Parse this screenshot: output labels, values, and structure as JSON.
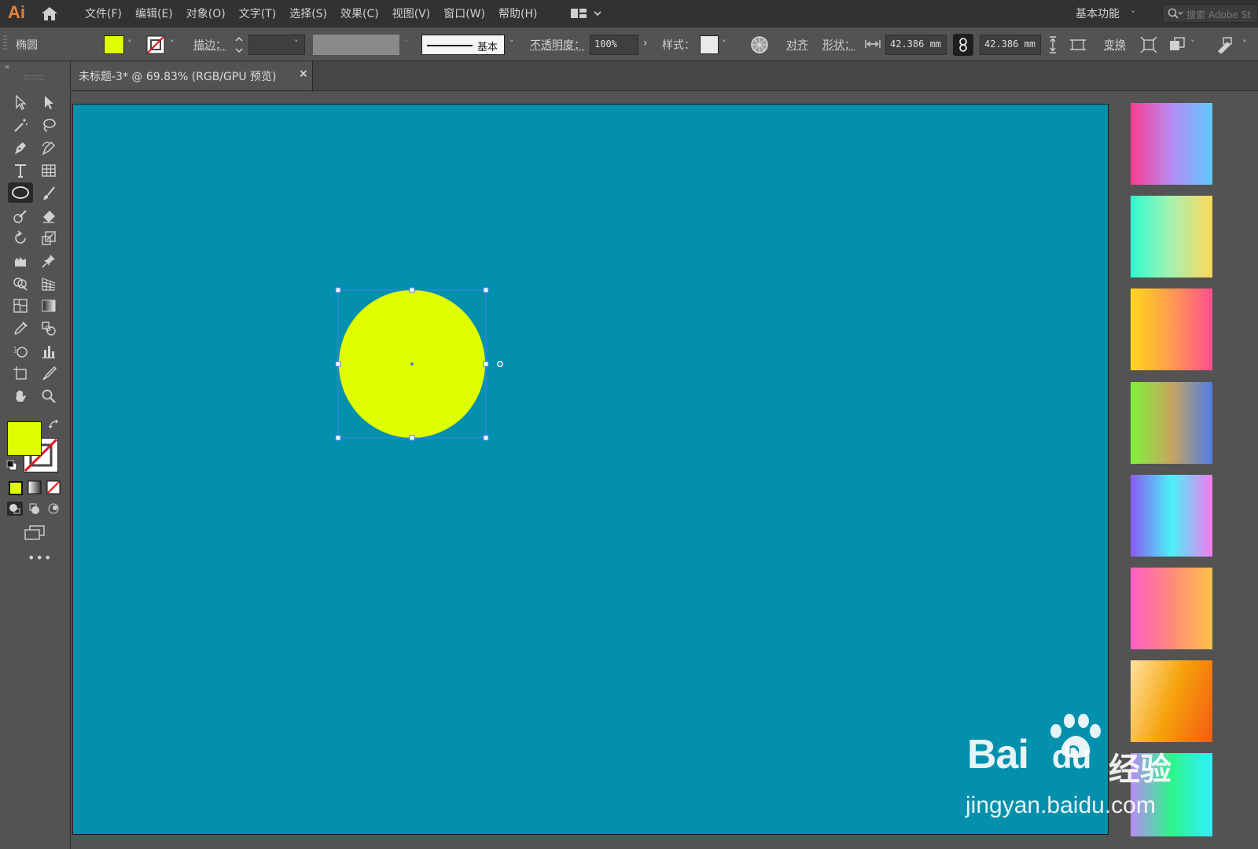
{
  "app": {
    "logo": "Ai"
  },
  "menu": {
    "items": [
      "文件(F)",
      "编辑(E)",
      "对象(O)",
      "文字(T)",
      "选择(S)",
      "效果(C)",
      "视图(V)",
      "窗口(W)",
      "帮助(H)"
    ],
    "workspace": "基本功能",
    "search_placeholder": "搜索 Adobe St"
  },
  "control": {
    "object_type": "椭圆",
    "fill_color": "#dfff00",
    "stroke_label": "描边：",
    "stroke_profile": "基本",
    "opacity_label": "不透明度：",
    "opacity_value": "100%",
    "style_label": "样式：",
    "align_label": "对齐",
    "shape_label": "形状：",
    "width_value": "42.386 mm",
    "height_value": "42.386 mm",
    "transform_label": "变换"
  },
  "tools": [
    "selection-tool-icon",
    "direct-selection-tool-icon",
    "magic-wand-tool-icon",
    "lasso-tool-icon",
    "pen-tool-icon",
    "curvature-tool-icon",
    "type-tool-icon",
    "grid-tool-icon",
    "ellipse-tool-icon",
    "paintbrush-tool-icon",
    "shaper-tool-icon",
    "eraser-tool-icon",
    "rotate-tool-icon",
    "scale-tool-icon",
    "puppet-warp-tool-icon",
    "pin-tool-icon",
    "shape-builder-tool-icon",
    "perspective-grid-tool-icon",
    "mesh-tool-icon",
    "gradient-tool-icon",
    "eyedropper-tool-icon",
    "blend-tool-icon",
    "symbol-sprayer-tool-icon",
    "graph-tool-icon",
    "artboard-tool-icon",
    "slice-tool-icon",
    "hand-tool-icon",
    "zoom-tool-icon"
  ],
  "selected_tool": "ellipse-tool-icon",
  "colors": {
    "fill": "#dfff00",
    "artboard": "#0290ad",
    "accent": "#e2843b"
  },
  "document": {
    "tab_title": "未标题-3* @ 69.83% (RGB/GPU 预览)",
    "close": "×"
  },
  "gradients": [
    [
      "#ff3b8f",
      "#b68cf5",
      "#5ec9ff"
    ],
    [
      "#2dfcd0",
      "#a8f2b0",
      "#ffd65a"
    ],
    [
      "#ffd81a",
      "#ff9a50",
      "#ff4f8e"
    ],
    [
      "#7ff23a",
      "#c7a560",
      "#4f7de6"
    ],
    [
      "#8b5af5",
      "#4af2f7",
      "#f57af0"
    ],
    [
      "#ff5ec8",
      "#ff8a7a",
      "#ffc24a"
    ],
    [
      "#ffe2a0",
      "#f5a20a",
      "#f55a12"
    ],
    [
      "#b88cf5",
      "#2df58a",
      "#2ef0ff"
    ]
  ],
  "watermark": {
    "brand_left": "Bai",
    "brand_mid": "du",
    "brand_right": "经验",
    "url": "jingyan.baidu.com"
  }
}
